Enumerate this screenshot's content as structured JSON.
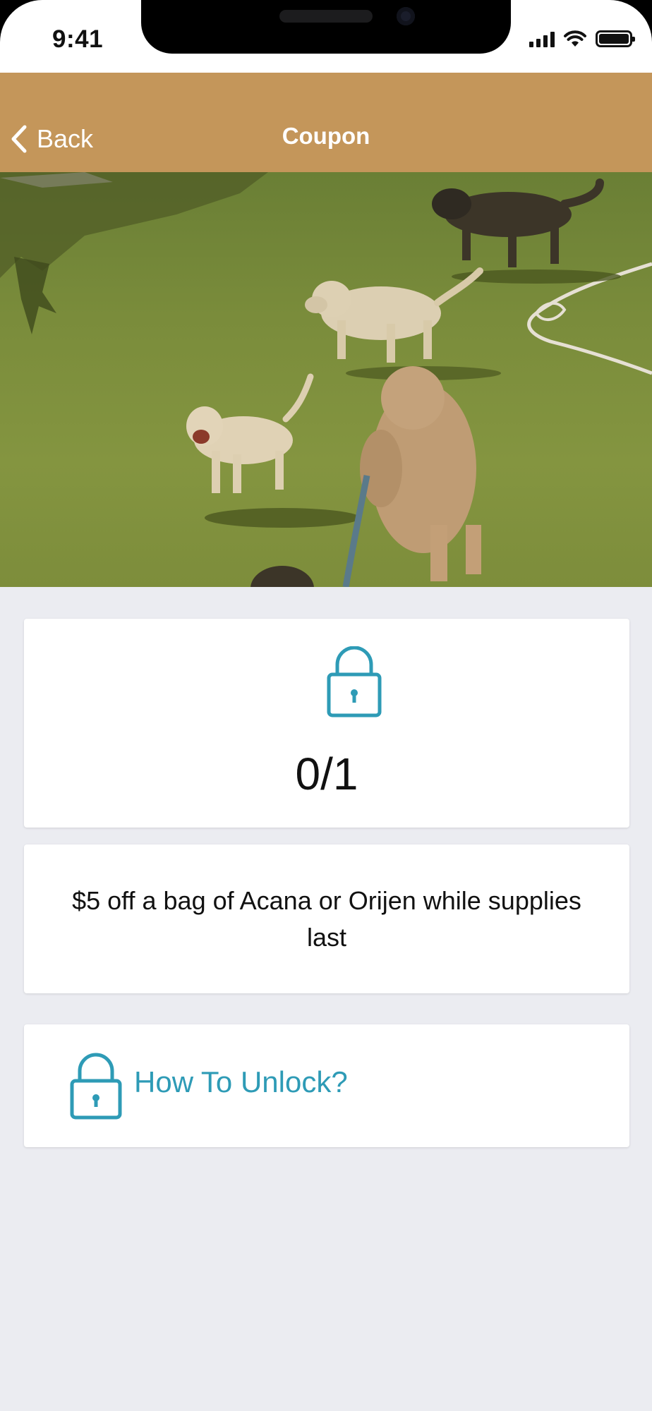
{
  "status_bar": {
    "time": "9:41"
  },
  "nav": {
    "back_label": "Back",
    "title": "Coupon"
  },
  "hero": {
    "image_description_icon": "dogs-photo"
  },
  "coupon": {
    "progress": "0/1",
    "offer": "$5 off a bag of Acana or Orijen while supplies last",
    "unlock_label": "How To Unlock?"
  },
  "colors": {
    "nav_background": "#c4965a",
    "accent": "#2e9bb6",
    "page_background": "#ebecf1"
  }
}
